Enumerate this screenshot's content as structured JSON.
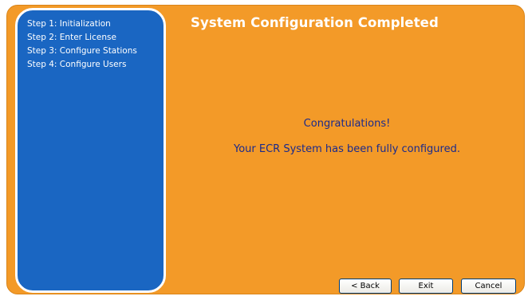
{
  "wizard": {
    "title": "System Configuration Completed",
    "steps": [
      {
        "label": "Step 1: Initialization"
      },
      {
        "label": "Step 2: Enter License"
      },
      {
        "label": "Step 3: Configure Stations"
      },
      {
        "label": "Step 4: Configure Users"
      }
    ],
    "messages": {
      "congrats": "Congratulations!",
      "detail": "Your ECR System has been fully configured."
    },
    "buttons": {
      "back_label": "< Back",
      "exit_label": "Exit",
      "cancel_label": "Cancel"
    }
  },
  "colors": {
    "panel_background": "#f39a28",
    "sidebar_background": "#1a66c2",
    "message_text": "#1a2a8c",
    "title_text": "#ffffff"
  }
}
